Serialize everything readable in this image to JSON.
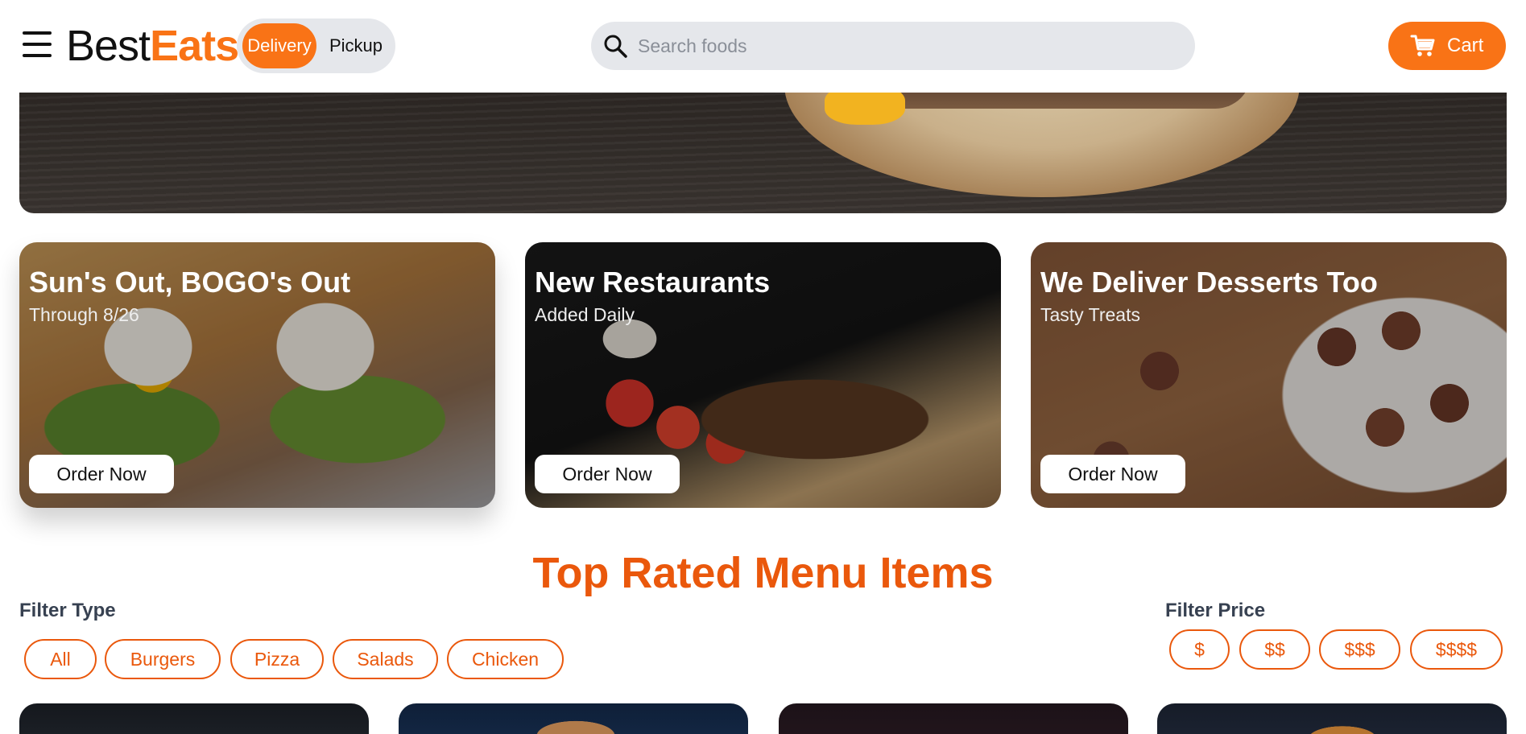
{
  "header": {
    "logo_part1": "Best",
    "logo_part2": "Eats",
    "mode_options": [
      "Delivery",
      "Pickup"
    ],
    "mode_selected": "Delivery",
    "search_placeholder": "Search foods",
    "search_value": "",
    "cart_label": "Cart"
  },
  "promos": [
    {
      "title": "Sun's Out, BOGO's Out",
      "subtitle": "Through 8/26",
      "button": "Order Now"
    },
    {
      "title": "New Restaurants",
      "subtitle": "Added Daily",
      "button": "Order Now"
    },
    {
      "title": "We Deliver Desserts Too",
      "subtitle": "Tasty Treats",
      "button": "Order Now"
    }
  ],
  "section": {
    "title": "Top Rated Menu Items"
  },
  "filters": {
    "type_label": "Filter Type",
    "types": [
      "All",
      "Burgers",
      "Pizza",
      "Salads",
      "Chicken"
    ],
    "price_label": "Filter Price",
    "prices": [
      "$",
      "$$",
      "$$$",
      "$$$$"
    ]
  },
  "colors": {
    "brand": "#f97316",
    "heading": "#ea580c",
    "pill_bg": "#e5e7eb"
  }
}
